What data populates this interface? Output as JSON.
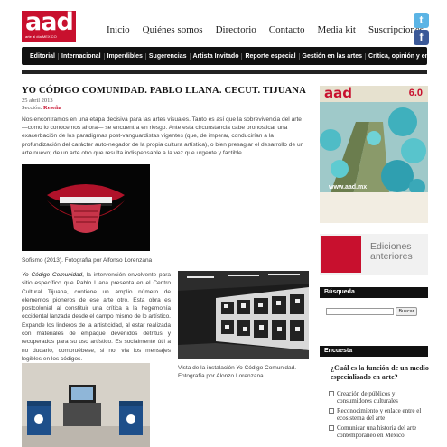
{
  "header": {
    "logo_text": "aad",
    "logo_sub": "arte al día MEXICO",
    "nav": [
      "Inicio",
      "Quiénes somos",
      "Directorio",
      "Contacto",
      "Media kit",
      "Suscripciones"
    ],
    "social": [
      {
        "name": "twitter-icon",
        "glyph": "t",
        "color": "#5bb4e5"
      },
      {
        "name": "facebook-icon",
        "glyph": "f",
        "color": "#3b5998"
      }
    ]
  },
  "menu": [
    "Editorial",
    "Internacional",
    "Imperdibles",
    "Sugerencias",
    "Artista Invitado",
    "Reporte especial",
    "Gestión en las artes",
    "Crítica, opinión y ensayo"
  ],
  "article": {
    "title": "YO CÓDIGO COMUNIDAD. PABLO LLANA. CECUT. TIJUANA",
    "date": "25 abril 2013",
    "section_label": "Sección:",
    "section_value": "Reseña",
    "intro": "Nos encontramos en una etapa decisiva para las artes visuales. Tanto es así que la sobrevivencia del arte —como lo conocemos ahora— se encuentra en riesgo. Ante esta circunstancia cabe pronosticar una exacerbación de los paradigmas post-vanguardistas vigentes (que, de imperar, conducirían a la profundización del carácter auto-negador de la propia cultura artística), o bien presagiar el desarrollo de un arte nuevo; de un arte otro que resulta indispensable a la vez que urgente y factible.",
    "caption1": "Sofismo (2013). Fotografía por Alfonso Lorenzana",
    "body2_title": "Yo Código Comunidad",
    "body2": ", la intervención envolvente para sitio específico que Pablo Llana presenta en el Centro Cultural Tijuana, contiene un amplio número de elementos pioneros de ese arte otro. Esta obra es postcolonial al constituir una crítica a la hegemonía occidental lanzada desde el campo mismo de lo artístico. Expande los linderos de la artisticidad, al estar realizada con materiales de empaque devenidos detritus y recuperados para su uso artístico. Es socialmente útil a no dudarlo, compruébese, si no, vía los mensajes legibles en los códigos.",
    "caption2": "Vista de la instalación Yo Código Comunidad. Fotografía por Alonzo Lorenzana."
  },
  "sidebar": {
    "mag_logo": "aad",
    "mag_issue": "6.0",
    "mag_url": "www.aad.mx",
    "prev_text": "Ediciones anteriores",
    "search_title": "Búsqueda",
    "search_placeholder": "",
    "search_button": "Buscar",
    "poll_title": "Encuesta",
    "poll_question": "¿Cuál es la función de un medio especializado en arte?",
    "poll_options": [
      "Creación de públicos y consumidores culturales",
      "Reconocimiento y enlace entre el ecosistema del arte",
      "Comunicar una historia del arte contemporáneo en México"
    ]
  },
  "colors": {
    "brand_red": "#c8102e",
    "menu_bg": "#111111",
    "twitter": "#5bb4e5",
    "facebook": "#3b5998"
  }
}
